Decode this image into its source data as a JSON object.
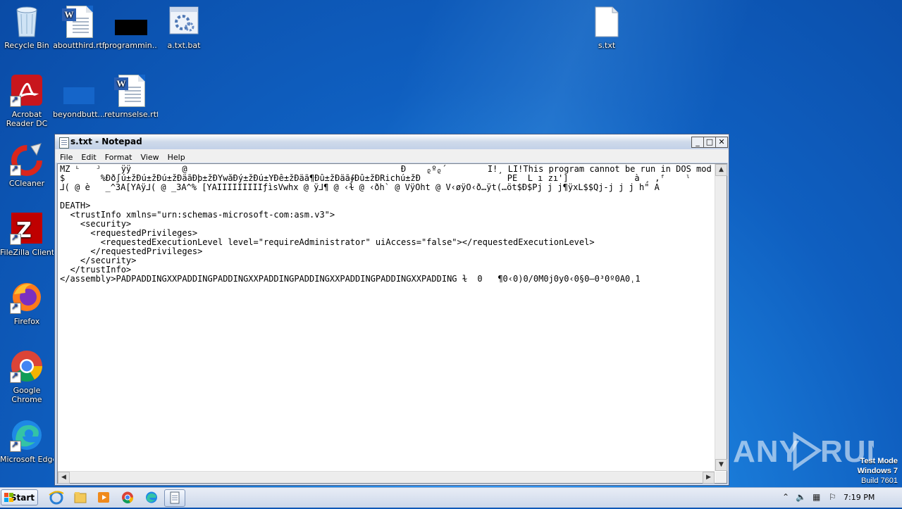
{
  "desktop_icons": [
    {
      "label": "Recycle Bin",
      "icon": "recycle-bin-icon"
    },
    {
      "label": "aboutthird.rtf",
      "icon": "word-document-icon"
    },
    {
      "label": "programmin...",
      "icon": "black-file-icon"
    },
    {
      "label": "a.txt.bat",
      "icon": "batch-file-icon"
    },
    {
      "label": "s.txt",
      "icon": "text-file-icon"
    },
    {
      "label": "Acrobat Reader DC",
      "icon": "acrobat-icon"
    },
    {
      "label": "beyondbutt...",
      "icon": "blue-file-icon"
    },
    {
      "label": "returnselse.rtf",
      "icon": "word-document-icon"
    },
    {
      "label": "CCleaner",
      "icon": "ccleaner-icon"
    },
    {
      "label": "FileZilla Client",
      "icon": "filezilla-icon"
    },
    {
      "label": "Firefox",
      "icon": "firefox-icon"
    },
    {
      "label": "Google Chrome",
      "icon": "chrome-icon"
    },
    {
      "label": "Microsoft Edge",
      "icon": "edge-icon"
    }
  ],
  "notepad": {
    "title": "s.txt - Notepad",
    "buttons": {
      "minimize": "_",
      "maximize": "□",
      "close": "✕"
    },
    "menu": [
      "File",
      "Edit",
      "Format",
      "View",
      "Help"
    ],
    "lines": [
      "MZ ᴸ   ᴶ    ÿÿ          @                                          Ð    ᵨºᵨ´        Í!¸ LÍ!This program cannot be run in DOS mod",
      "$       %Ðð∫ú±žÐú±žÐú±žÐäãÐþ±žÐÝwåÐý±žÐú±ÝÐê±žÐäã¶Ðû±žÐäã∳Ðû±žÐRichú±žÐ                 PE  L ı zı']             à ¸ ,ᶠ    ˡ",
      "⅃( @ è   _^3Ä[YÄÿ⅃( @ _3À^% [YÄÌÌÌÌÌÌÌÌÌƒìsVwhx @ ÿ⅃¶ @ ‹ɫ @ ‹ðh` @ VÿÖht @ V‹øÿÖ‹ð…ÿt(…öt$Ð$Pj j j¶ÿxL$$Qj-j j j h\" À",
      "",
      "DEATH>",
      "  <trustInfo xmlns=\"urn:schemas-microsoft-com:asm.v3\">",
      "    <security>",
      "      <requestedPrivileges>",
      "        <requestedExecutionLevel level=\"requireAdministrator\" uiAccess=\"false\"></requestedExecutionLevel>",
      "      </requestedPrivileges>",
      "    </security>",
      "  </trustInfo>",
      "</assembly>PADPADDINGXXPADDINGPADDINGXXPADDINGPADDINGXXPADDINGPADDINGXXPADDING ɫ  0   ¶0‹0)0/0M0j0y0‹0§0–0³0º0Ä0ˌ1"
    ]
  },
  "watermark": {
    "text": "ANY RUN",
    "line1": "Test Mode",
    "line2": "Windows 7",
    "line3": "Build 7601"
  },
  "taskbar": {
    "start_label": "Start",
    "pinned": [
      "ie-icon",
      "explorer-icon",
      "media-player-icon",
      "chrome-icon",
      "edge-icon",
      "notepad-icon"
    ],
    "clock": "7:19 PM",
    "tray_icons": [
      "chevron-up-icon",
      "speaker-icon",
      "network-icon",
      "flag-icon"
    ]
  }
}
